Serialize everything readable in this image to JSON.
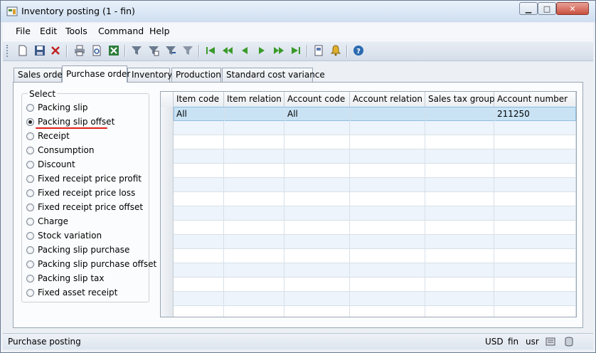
{
  "window": {
    "title": "Inventory posting (1 - fin)"
  },
  "menu": [
    "File",
    "Edit",
    "Tools",
    "Command",
    "Help"
  ],
  "tabs": [
    "Sales order",
    "Purchase order",
    "Inventory",
    "Production",
    "Standard cost variance"
  ],
  "active_tab": "Purchase order",
  "select_group": {
    "label": "Select",
    "options": [
      "Packing slip",
      "Packing slip offset",
      "Receipt",
      "Consumption",
      "Discount",
      "Fixed receipt price profit",
      "Fixed receipt price loss",
      "Fixed receipt price offset",
      "Charge",
      "Stock variation",
      "Packing slip purchase",
      "Packing slip purchase offset",
      "Packing slip tax",
      "Fixed asset receipt"
    ],
    "selected": "Packing slip offset"
  },
  "grid": {
    "columns": [
      "Item code",
      "Item relation",
      "Account code",
      "Account relation",
      "Sales tax group",
      "Account number"
    ],
    "rows": [
      [
        "All",
        "",
        "All",
        "",
        "",
        "211250"
      ]
    ]
  },
  "status": {
    "text": "Purchase posting",
    "currency": "USD",
    "company": "fin",
    "user": "usr"
  }
}
